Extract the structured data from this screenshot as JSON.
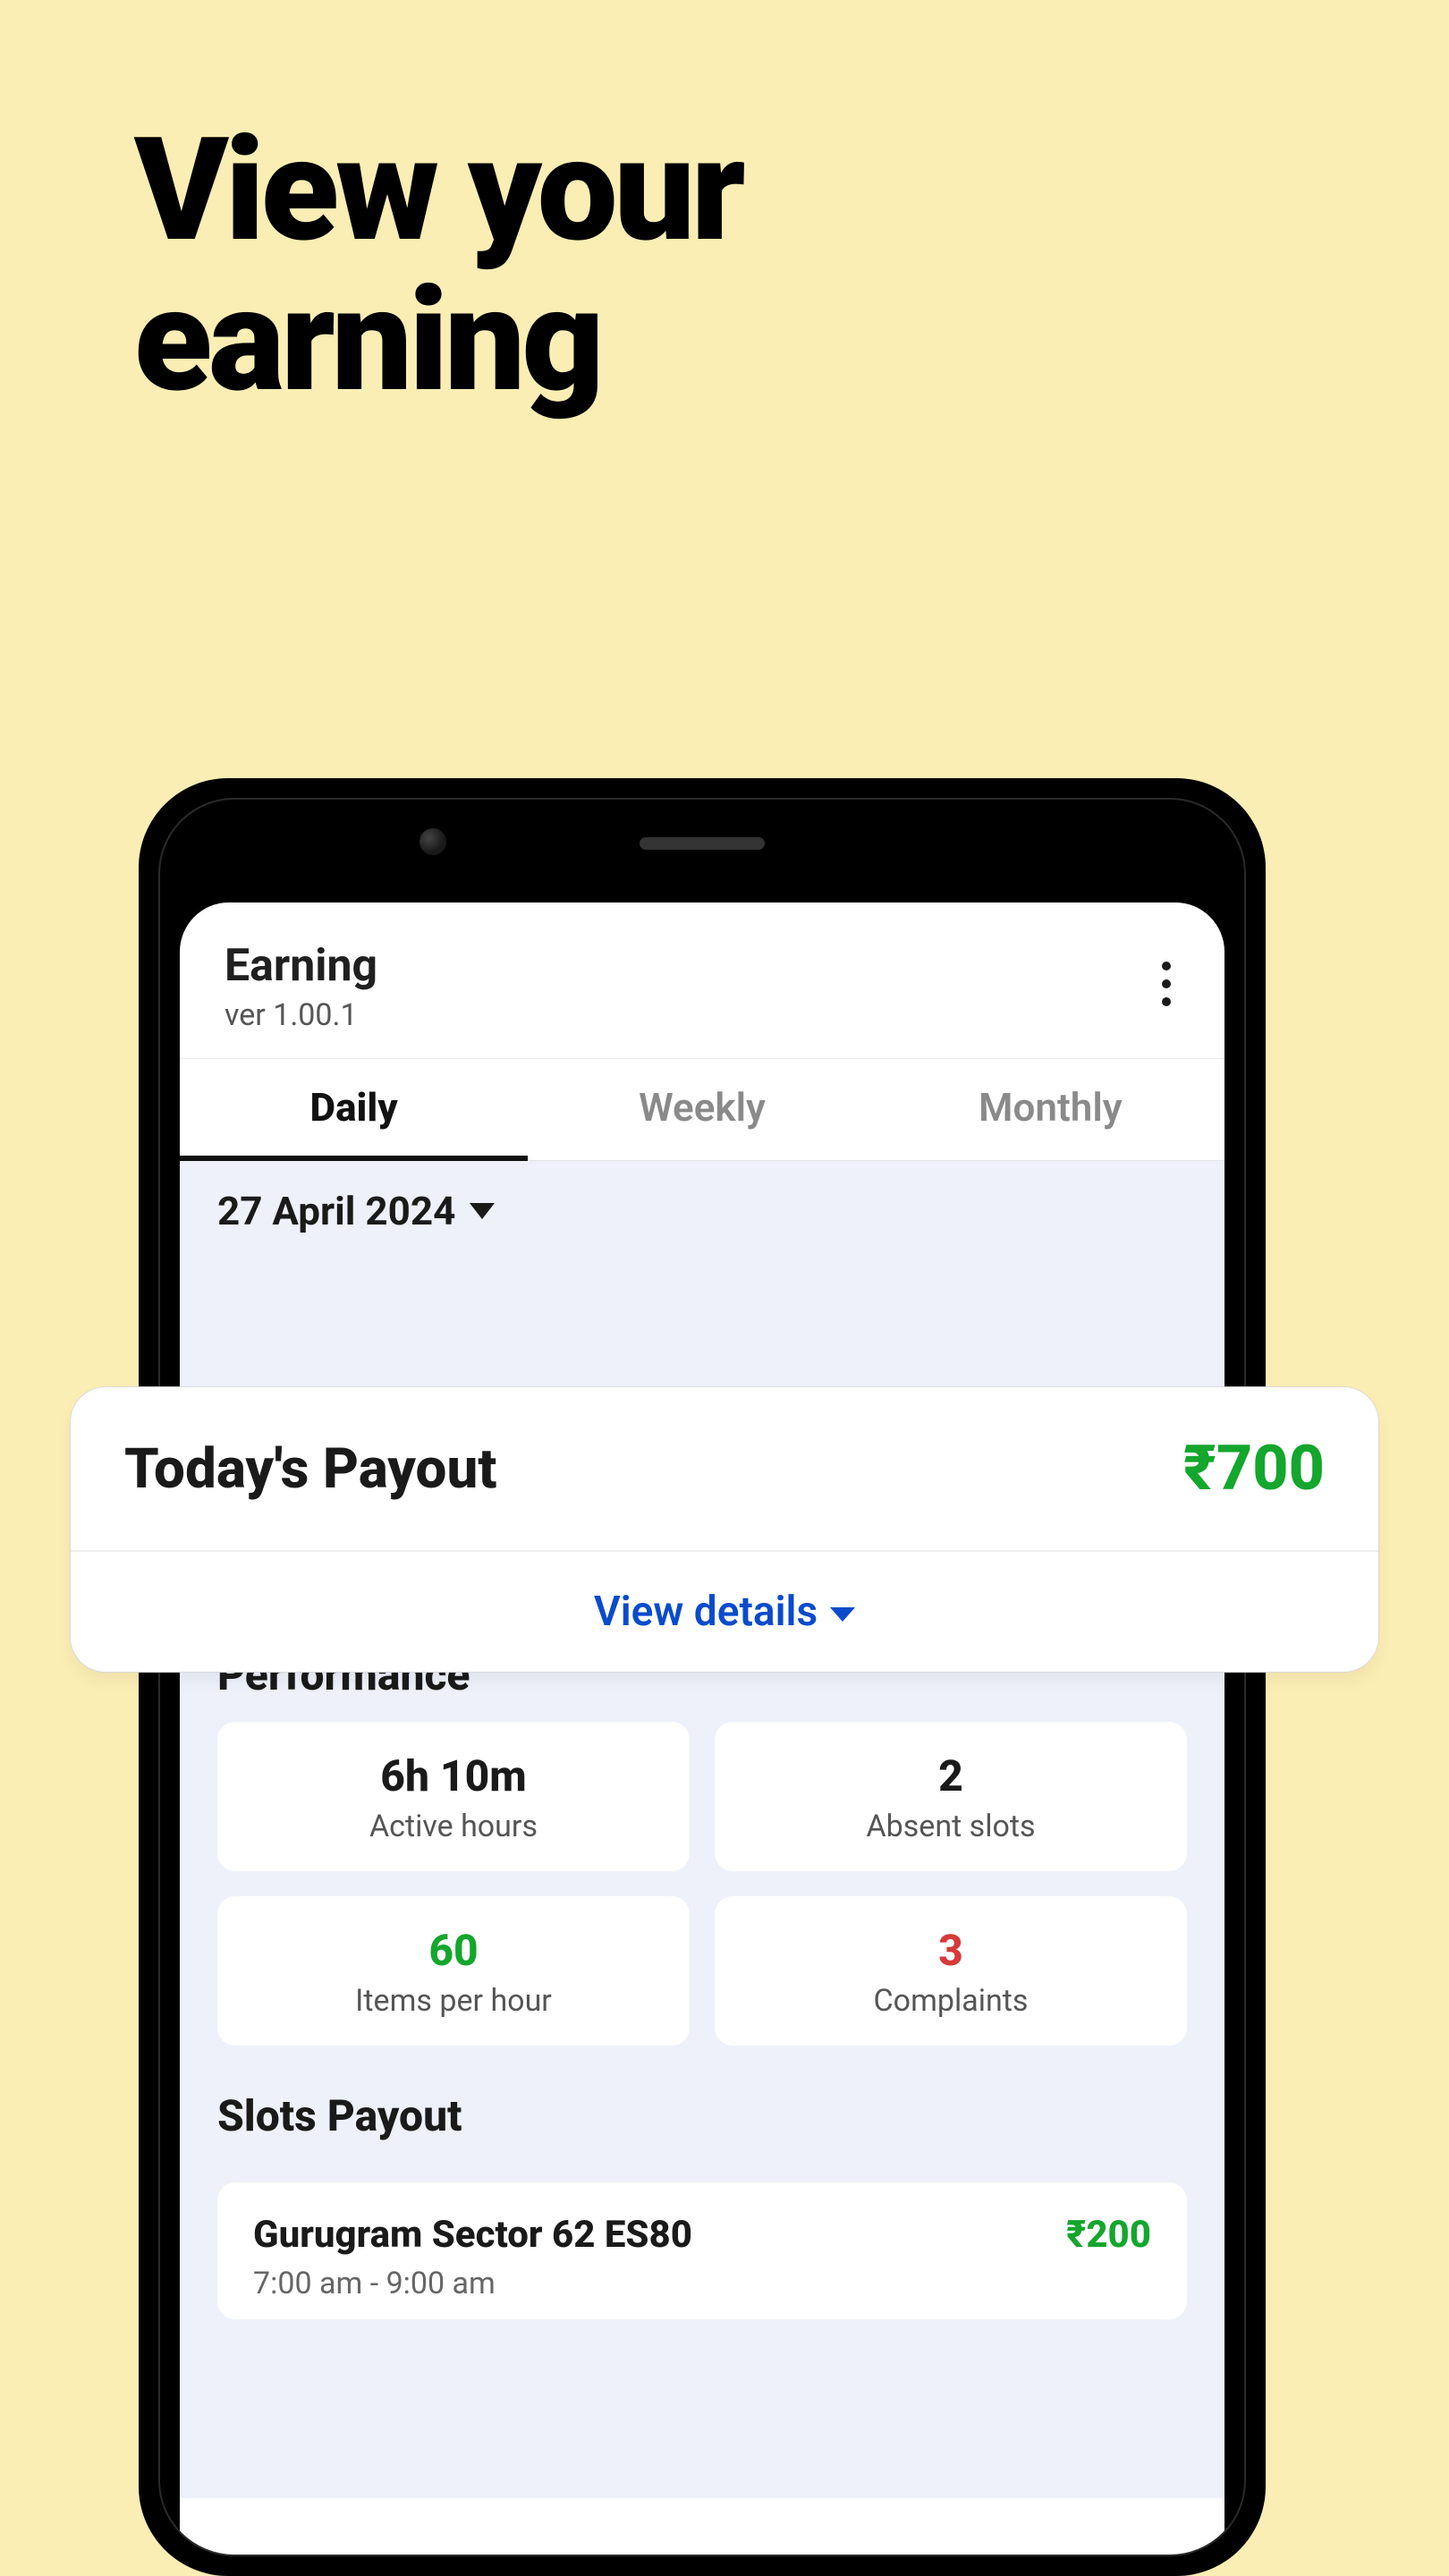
{
  "page_heading": "View your\nearning",
  "header": {
    "title": "Earning",
    "version": "ver 1.00.1"
  },
  "tabs": {
    "daily": "Daily",
    "weekly": "Weekly",
    "monthly": "Monthly"
  },
  "date_selector": "27 April 2024",
  "payout": {
    "label": "Today's Payout",
    "amount": "₹700",
    "details_link": "View details"
  },
  "performance": {
    "title": "Performance",
    "stats": {
      "active_hours": {
        "value": "6h 10m",
        "label": "Active hours"
      },
      "absent_slots": {
        "value": "2",
        "label": "Absent slots"
      },
      "items_per_hour": {
        "value": "60",
        "label": "Items per hour"
      },
      "complaints": {
        "value": "3",
        "label": "Complaints"
      }
    }
  },
  "slots": {
    "title": "Slots Payout",
    "items": [
      {
        "location": "Gurugram Sector 62 ES80",
        "amount": "₹200",
        "time": "7:00 am - 9:00 am"
      }
    ]
  },
  "colors": {
    "background": "#fbeeb4",
    "green": "#14a62d",
    "red": "#d63a3a",
    "blue": "#0a4bcc",
    "screen_body": "#eef1fa"
  }
}
